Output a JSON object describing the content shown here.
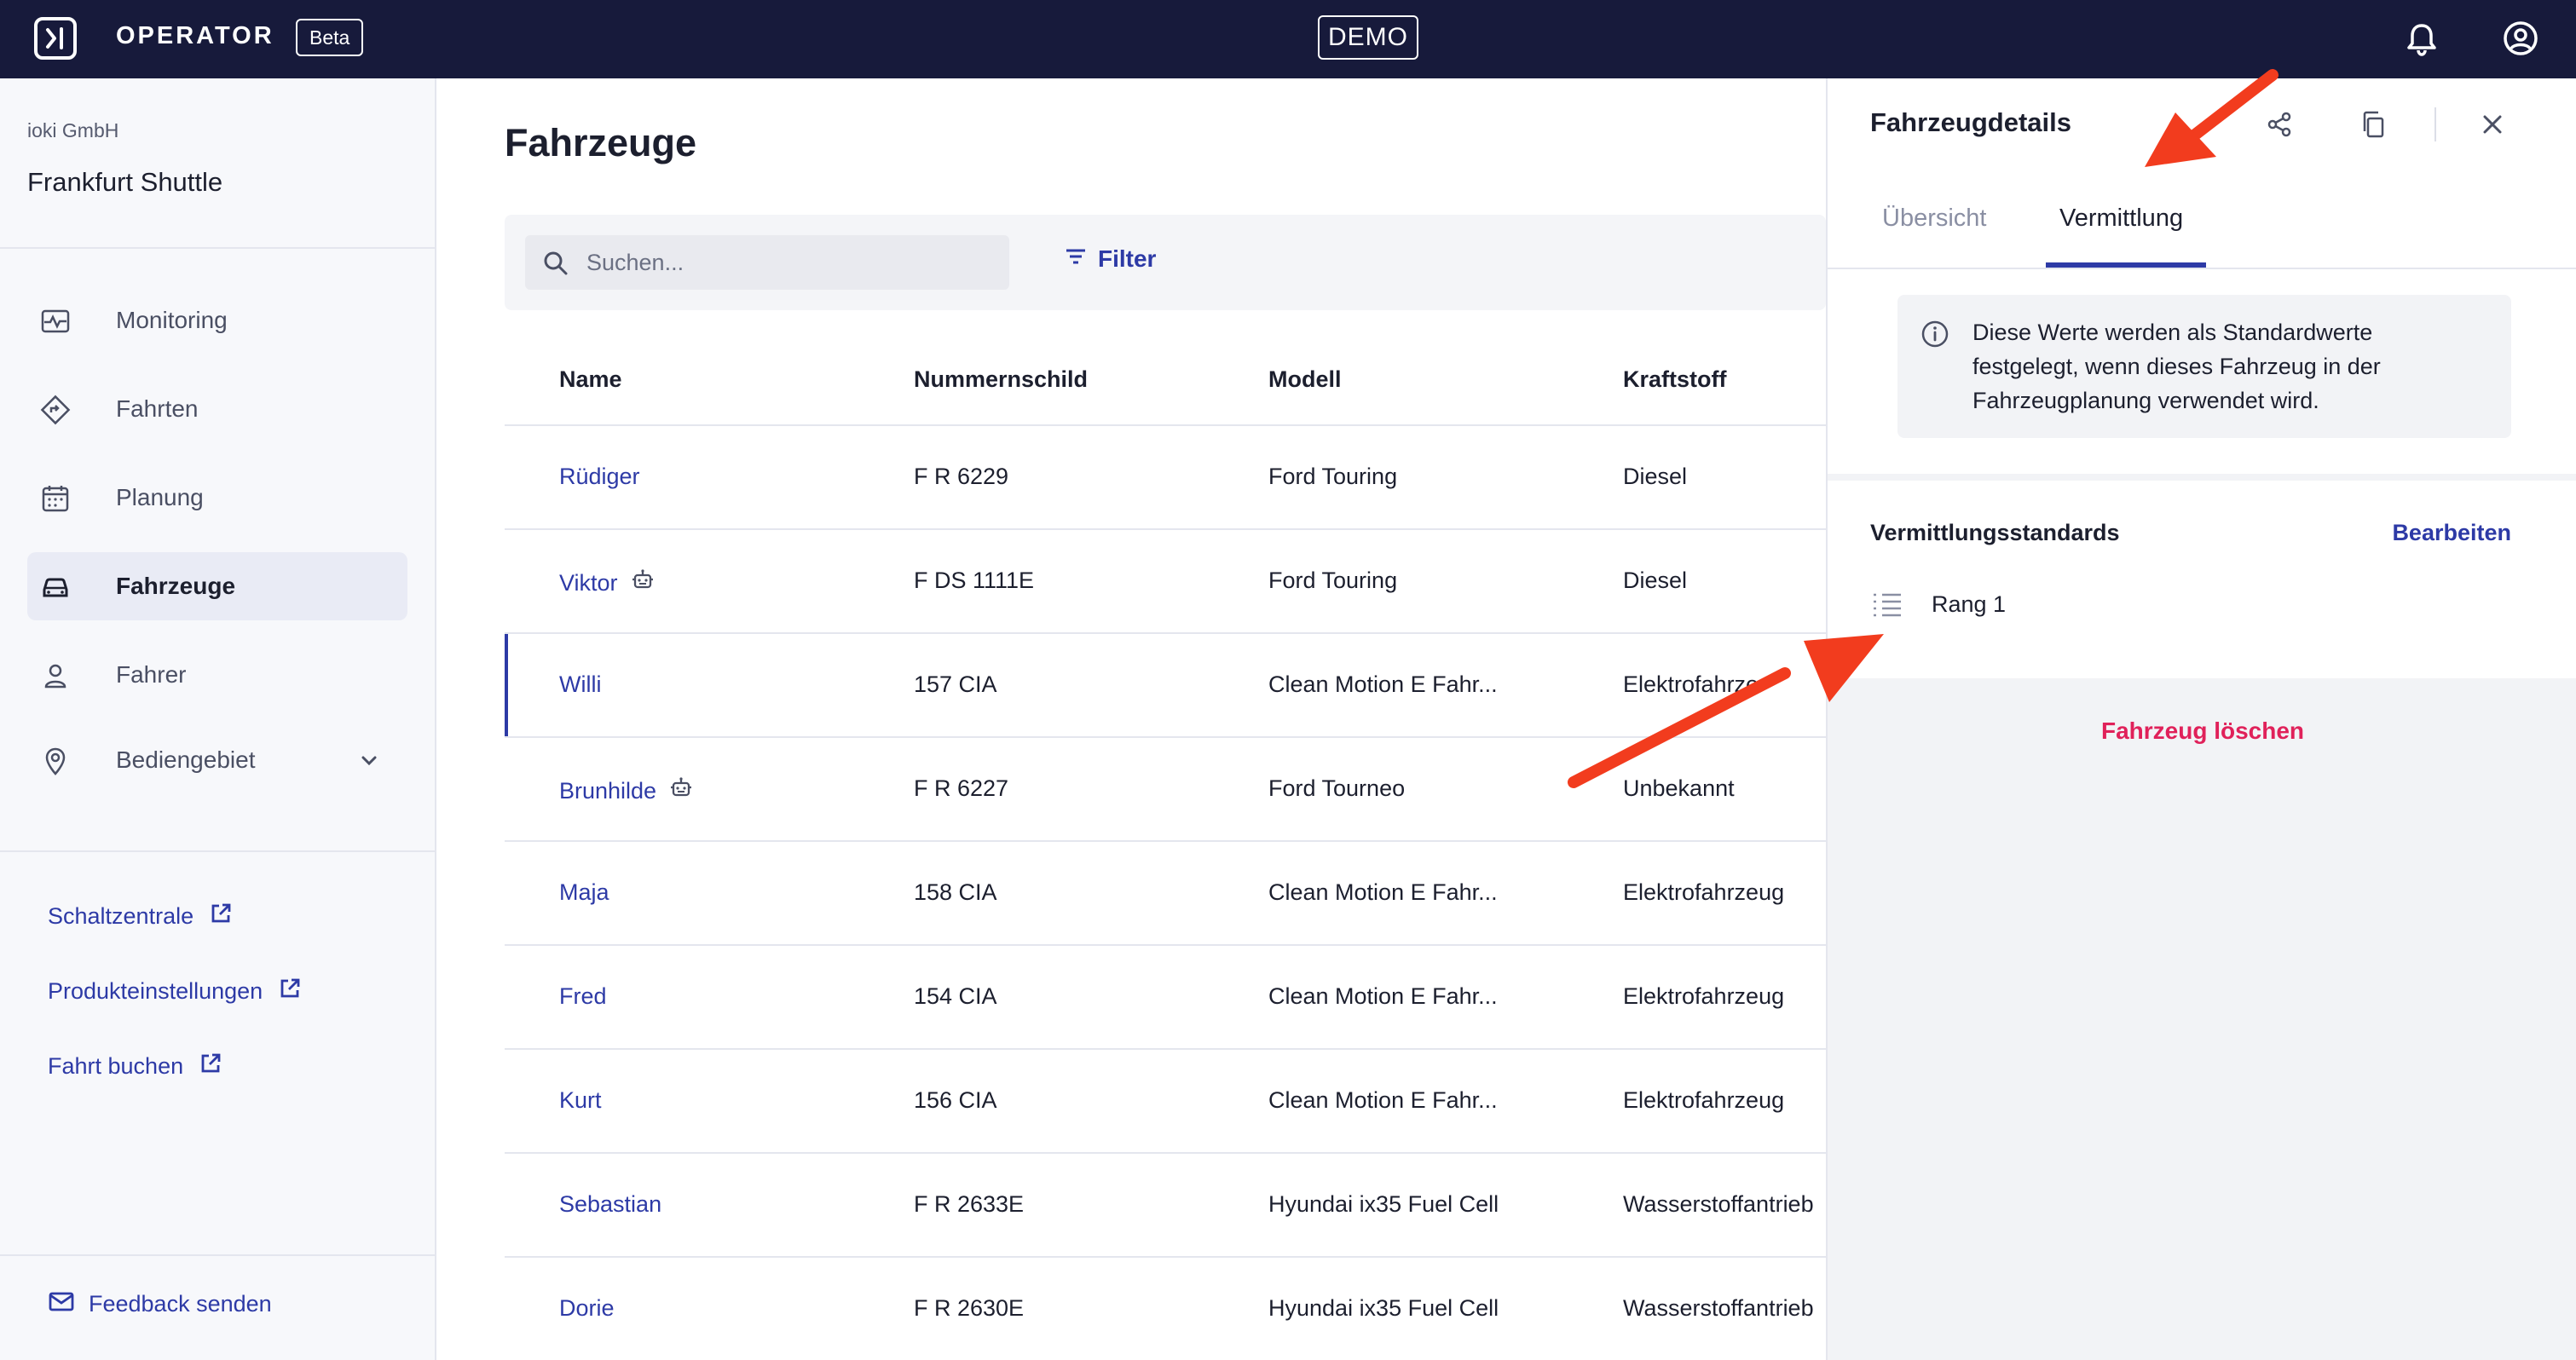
{
  "topbar": {
    "brand": "OPERATOR",
    "badge": "Beta",
    "environment": "DEMO",
    "icons": [
      "logo-icon",
      "bell-icon",
      "user-account-icon"
    ]
  },
  "sidebar": {
    "org": "ioki GmbH",
    "project": "Frankfurt Shuttle",
    "items": [
      {
        "label": "Monitoring",
        "icon": "monitoring-icon",
        "active": false
      },
      {
        "label": "Fahrten",
        "icon": "route-icon",
        "active": false
      },
      {
        "label": "Planung",
        "icon": "calendar-icon",
        "active": false
      },
      {
        "label": "Fahrzeuge",
        "icon": "car-icon",
        "active": true
      },
      {
        "label": "Fahrer",
        "icon": "person-icon",
        "active": false
      },
      {
        "label": "Bediengebiet",
        "icon": "location-pin-icon",
        "active": false
      }
    ],
    "links": [
      {
        "label": "Schaltzentrale"
      },
      {
        "label": "Produkteinstellungen"
      },
      {
        "label": "Fahrt buchen"
      }
    ],
    "feedback": "Feedback senden"
  },
  "main": {
    "title": "Fahrzeuge",
    "search_placeholder": "Suchen...",
    "filter_label": "Filter",
    "columns": [
      "Name",
      "Nummernschild",
      "Modell",
      "Kraftstoff"
    ],
    "rows": [
      {
        "name": "Rüdiger",
        "plate": "F R 6229",
        "model": "Ford Touring",
        "fuel": "Diesel",
        "robot": false
      },
      {
        "name": "Viktor",
        "plate": "F DS 1111E",
        "model": "Ford Touring",
        "fuel": "Diesel",
        "robot": true
      },
      {
        "name": "Willi",
        "plate": "157 CIA",
        "model": "Clean Motion E Fahr...",
        "fuel": "Elektrofahrze",
        "robot": false,
        "selected": true
      },
      {
        "name": "Brunhilde",
        "plate": "F R 6227",
        "model": "Ford Tourneo",
        "fuel": "Unbekannt",
        "robot": true
      },
      {
        "name": "Maja",
        "plate": "158 CIA",
        "model": "Clean Motion E Fahr...",
        "fuel": "Elektrofahrzeug",
        "robot": false
      },
      {
        "name": "Fred",
        "plate": "154 CIA",
        "model": "Clean Motion E Fahr...",
        "fuel": "Elektrofahrzeug",
        "robot": false
      },
      {
        "name": "Kurt",
        "plate": "156 CIA",
        "model": "Clean Motion E Fahr...",
        "fuel": "Elektrofahrzeug",
        "robot": false
      },
      {
        "name": "Sebastian",
        "plate": "F R 2633E",
        "model": "Hyundai ix35 Fuel Cell",
        "fuel": "Wasserstoffantrieb",
        "robot": false
      },
      {
        "name": "Dorie",
        "plate": "F R 2630E",
        "model": "Hyundai ix35 Fuel Cell",
        "fuel": "Wasserstoffantrieb",
        "robot": false
      }
    ]
  },
  "panel": {
    "title": "Fahrzeugdetails",
    "tabs": [
      {
        "label": "Übersicht",
        "active": false
      },
      {
        "label": "Vermittlung",
        "active": true
      }
    ],
    "info": "Diese Werte werden als Standardwerte festgelegt, wenn dieses Fahrzeug in der Fahrzeugplanung verwendet wird.",
    "standards_title": "Vermittlungsstandards",
    "edit_label": "Bearbeiten",
    "rank_label": "Rang 1",
    "delete_label": "Fahrzeug löschen"
  },
  "colors": {
    "topbar": "#171a3b",
    "accent": "#2d3aa6",
    "danger": "#e0215a",
    "annotation_arrow": "#f23c1e"
  }
}
